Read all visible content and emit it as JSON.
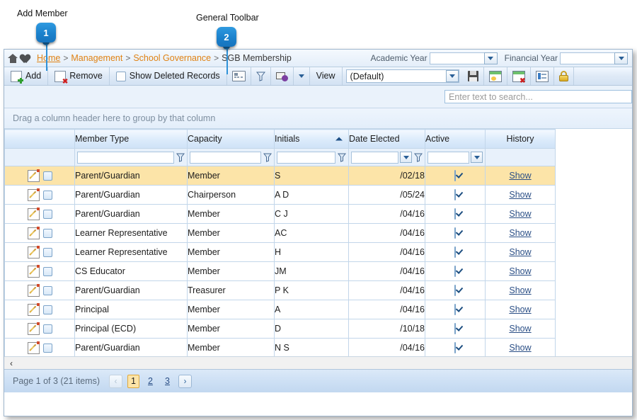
{
  "annotations": [
    {
      "label": "Add Member",
      "number": "1"
    },
    {
      "label": "General Toolbar",
      "number": "2"
    }
  ],
  "breadcrumb": {
    "home_icon": "home-icon",
    "favorite_icon": "heart-icon",
    "items": [
      {
        "text": "Home",
        "link": true
      },
      {
        "text": "Management",
        "link": true
      },
      {
        "text": "School Governance",
        "link": true
      },
      {
        "text": "SGB Membership",
        "link": false
      }
    ],
    "separator": ">"
  },
  "year_filters": {
    "academic_label": "Academic Year",
    "academic_value": "",
    "financial_label": "Financial Year",
    "financial_value": ""
  },
  "toolbar": {
    "add_label": "Add",
    "remove_label": "Remove",
    "show_deleted_label": "Show Deleted Records",
    "column_chooser_icon": "grid-columns-icon",
    "filter_icon": "funnel-filter-icon",
    "export_icon": "export-mail-icon",
    "export_dropdown_icon": "chevron-down-icon",
    "view_label": "View",
    "view_value": "(Default)",
    "save_icon": "save-floppy-icon",
    "new_view_icon": "new-view-icon",
    "delete_view_icon": "delete-view-icon",
    "view_properties_icon": "view-properties-icon",
    "lock_icon": "lock-icon"
  },
  "search": {
    "placeholder": "Enter text to search...",
    "value": ""
  },
  "group_panel": {
    "text": "Drag a column header here to group by that column"
  },
  "grid": {
    "columns": [
      {
        "label": "",
        "key": "actions"
      },
      {
        "label": "Member Type",
        "key": "member_type"
      },
      {
        "label": "Capacity",
        "key": "capacity"
      },
      {
        "label": "Initials",
        "key": "initials",
        "sort": "asc"
      },
      {
        "label": "Date Elected",
        "key": "date_elected"
      },
      {
        "label": "Active",
        "key": "active"
      },
      {
        "label": "History",
        "key": "history"
      }
    ],
    "filter_row": {
      "member_type": "",
      "capacity": "",
      "initials": "",
      "date_elected": "",
      "active": ""
    },
    "history_link_label": "Show",
    "rows": [
      {
        "member_type": "Parent/Guardian",
        "capacity": "Member",
        "initials": "S",
        "date_elected": "/02/18",
        "active": true,
        "history": "Show",
        "selected": true
      },
      {
        "member_type": "Parent/Guardian",
        "capacity": "Chairperson",
        "initials": "A D",
        "date_elected": "/05/24",
        "active": true,
        "history": "Show",
        "selected": false
      },
      {
        "member_type": "Parent/Guardian",
        "capacity": "Member",
        "initials": "C J",
        "date_elected": "/04/16",
        "active": true,
        "history": "Show",
        "selected": false
      },
      {
        "member_type": "Learner Representative",
        "capacity": "Member",
        "initials": "AC",
        "date_elected": "/04/16",
        "active": true,
        "history": "Show",
        "selected": false
      },
      {
        "member_type": "Learner Representative",
        "capacity": "Member",
        "initials": "H",
        "date_elected": "/04/16",
        "active": true,
        "history": "Show",
        "selected": false
      },
      {
        "member_type": "CS Educator",
        "capacity": "Member",
        "initials": "JM",
        "date_elected": "/04/16",
        "active": true,
        "history": "Show",
        "selected": false
      },
      {
        "member_type": "Parent/Guardian",
        "capacity": "Treasurer",
        "initials": "P K",
        "date_elected": "/04/16",
        "active": true,
        "history": "Show",
        "selected": false
      },
      {
        "member_type": "Principal",
        "capacity": "Member",
        "initials": "A",
        "date_elected": "/04/16",
        "active": true,
        "history": "Show",
        "selected": false
      },
      {
        "member_type": "Principal (ECD)",
        "capacity": "Member",
        "initials": "D",
        "date_elected": "/10/18",
        "active": true,
        "history": "Show",
        "selected": false
      },
      {
        "member_type": "Parent/Guardian",
        "capacity": "Member",
        "initials": "N S",
        "date_elected": "/04/16",
        "active": true,
        "history": "Show",
        "selected": false
      }
    ]
  },
  "pager": {
    "summary": "Page 1 of 3 (21 items)",
    "prev_label": "‹",
    "next_label": "›",
    "pages": [
      "1",
      "2",
      "3"
    ],
    "active_page": "1"
  },
  "colors": {
    "accent_orange": "#e08214",
    "selected_row": "#fce4a8",
    "header_blue": "#cfe2f7",
    "link_blue": "#2b4f86",
    "callout_blue": "#1b81cc"
  }
}
